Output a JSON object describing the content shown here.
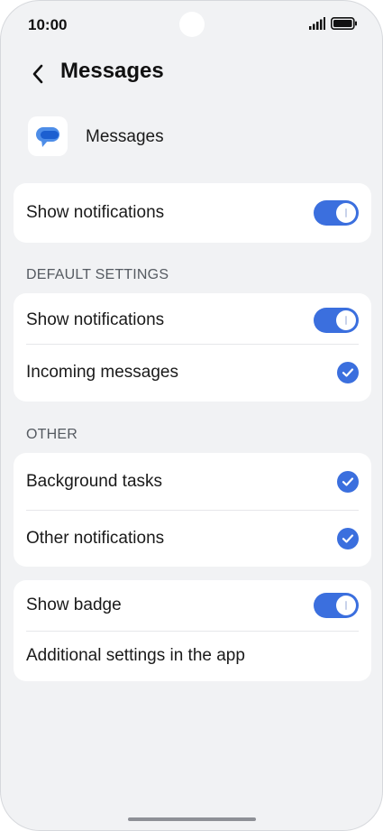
{
  "status_bar": {
    "time": "10:00",
    "signal_icon": "signal-icon",
    "battery_icon": "battery-icon"
  },
  "header": {
    "title": "Messages",
    "back_icon": "chevron-left-icon"
  },
  "app": {
    "name": "Messages",
    "icon": "messages-app-icon"
  },
  "main_toggle": {
    "label": "Show notifications",
    "state": "on"
  },
  "default_settings": {
    "header": "DEFAULT SETTINGS",
    "items": [
      {
        "label": "Show notifications",
        "control": "toggle",
        "state": "on"
      },
      {
        "label": "Incoming messages",
        "control": "checkbox",
        "state": "checked"
      }
    ]
  },
  "other": {
    "header": "OTHER",
    "items": [
      {
        "label": "Background tasks",
        "control": "checkbox",
        "state": "checked"
      },
      {
        "label": "Other notifications",
        "control": "checkbox",
        "state": "checked"
      }
    ]
  },
  "extra": {
    "items": [
      {
        "label": "Show badge",
        "control": "toggle",
        "state": "on"
      },
      {
        "label": "Additional settings in the app",
        "control": "link"
      }
    ]
  },
  "colors": {
    "accent": "#3b6fde",
    "background": "#f1f2f4",
    "card": "#ffffff"
  }
}
